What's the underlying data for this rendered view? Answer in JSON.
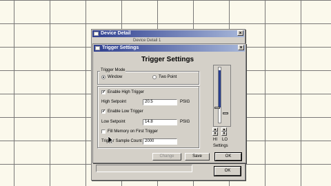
{
  "device_window": {
    "title": "Device Detail",
    "subtitle": "Device Detail 1"
  },
  "trigger_dialog": {
    "title": "Trigger Settings",
    "heading": "Trigger Settings",
    "trigger_mode": {
      "group_label": "Trigger Mode",
      "options": [
        "Window",
        "Two Point"
      ],
      "selected": "Window"
    },
    "enable_high": {
      "label": "Enable High Trigger",
      "checked": true
    },
    "high_setpoint": {
      "label": "High Setpoint",
      "value": "20.5",
      "unit": "PSIG"
    },
    "enable_low": {
      "label": "Enable Low Trigger",
      "checked": true
    },
    "low_setpoint": {
      "label": "Low Setpoint",
      "value": "14.8",
      "unit": "PSIG"
    },
    "fill_memory": {
      "label": "Fill Memory on First Trigger",
      "checked": false
    },
    "sample_count": {
      "label": "Trigger Sample Count",
      "value": "2000"
    },
    "slider": {
      "labels": [
        "HI",
        "LO"
      ],
      "caption": "Settings"
    },
    "buttons": {
      "change": "Change",
      "save": "Save",
      "ok": "OK"
    }
  },
  "device_buttons": {
    "ok": "OK"
  },
  "colors": {
    "title_start": "#2f3f8f",
    "title_end": "#a7b7d9",
    "face": "#d4d0c8",
    "slider_fill": "#2a3f8f"
  }
}
